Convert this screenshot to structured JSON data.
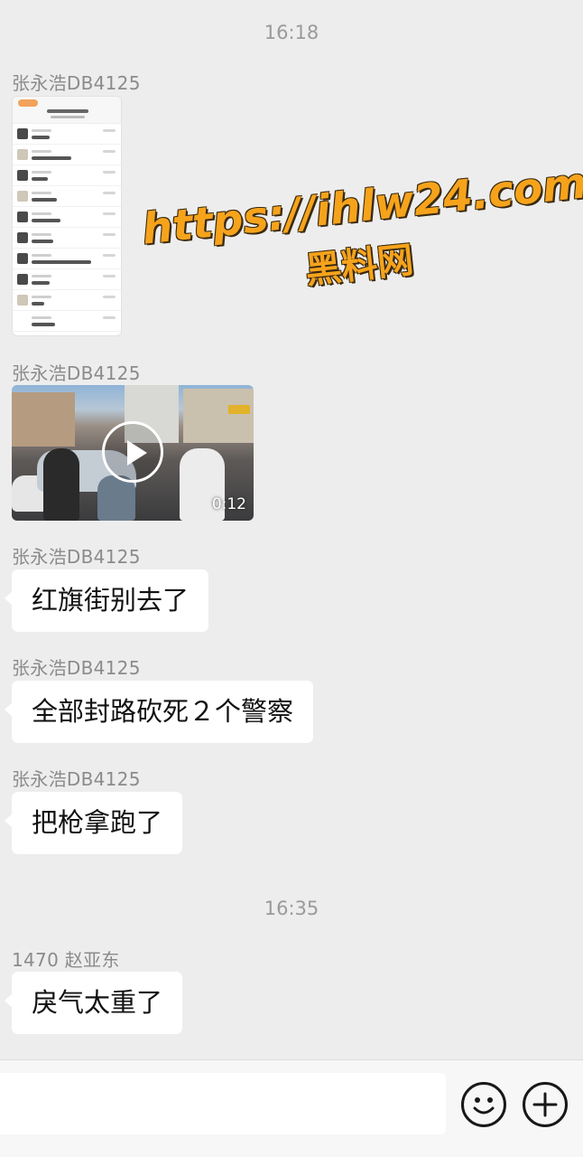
{
  "timestamps": [
    "16:18",
    "16:35"
  ],
  "messages": [
    {
      "sender": "张永浩DB4125",
      "type": "image"
    },
    {
      "sender": "张永浩DB4125",
      "type": "video",
      "duration": "0:12"
    },
    {
      "sender": "张永浩DB4125",
      "type": "text",
      "text": "红旗街别去了"
    },
    {
      "sender": "张永浩DB4125",
      "type": "text",
      "text": "全部封路砍死２个警察"
    },
    {
      "sender": "张永浩DB4125",
      "type": "text",
      "text": "把枪拿跑了"
    },
    {
      "sender": "1470 赵亚东",
      "type": "text",
      "text": "戾气太重了"
    }
  ],
  "watermark": {
    "line1": "https://ihlw24.com",
    "line2": "黑料网"
  },
  "input_bar": {
    "emoji_icon": "emoji-smile-icon",
    "plus_icon": "plus-circle-icon"
  },
  "colors": {
    "background": "#ededed",
    "bubble": "#ffffff",
    "watermark": "#f6a31c"
  }
}
